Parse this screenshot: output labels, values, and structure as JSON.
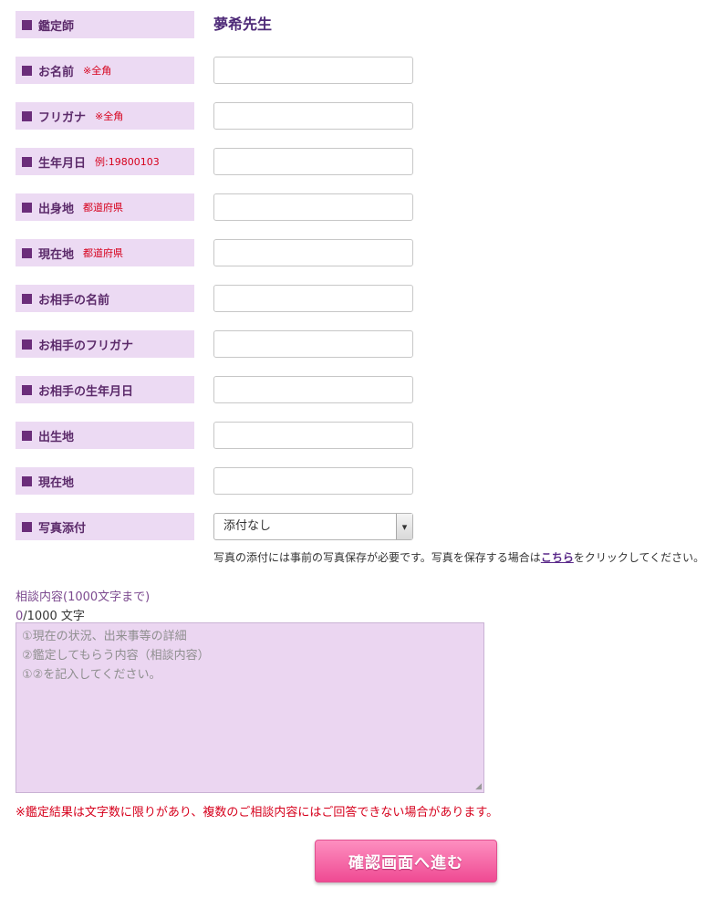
{
  "form": {
    "fields": [
      {
        "label": "鑑定師",
        "note": "",
        "type": "static",
        "value": "夢希先生"
      },
      {
        "label": "お名前",
        "note": "※全角",
        "type": "input",
        "value": ""
      },
      {
        "label": "フリガナ",
        "note": "※全角",
        "type": "input",
        "value": ""
      },
      {
        "label": "生年月日",
        "note": "例:19800103",
        "type": "input",
        "value": ""
      },
      {
        "label": "出身地",
        "note": "都道府県",
        "type": "input",
        "value": ""
      },
      {
        "label": "現在地",
        "note": "都道府県",
        "type": "input",
        "value": ""
      },
      {
        "label": "お相手の名前",
        "note": "",
        "type": "input",
        "value": ""
      },
      {
        "label": "お相手のフリガナ",
        "note": "",
        "type": "input",
        "value": ""
      },
      {
        "label": "お相手の生年月日",
        "note": "",
        "type": "input",
        "value": ""
      },
      {
        "label": "出生地",
        "note": "",
        "type": "input",
        "value": ""
      },
      {
        "label": "現在地",
        "note": "",
        "type": "input",
        "value": ""
      },
      {
        "label": "写真添付",
        "note": "",
        "type": "select",
        "value": "添付なし"
      }
    ],
    "photo_note_before": "写真の添付には事前の写真保存が必要です。写真を保存する場合は",
    "photo_note_link": "こちら",
    "photo_note_after": "をクリックしてください。"
  },
  "consultation": {
    "label": "相談内容(1000文字まで)",
    "count_current": "0",
    "count_suffix": "/1000 文字",
    "placeholder": "①現在の状況、出来事等の詳細\n②鑑定してもらう内容（相談内容）\n①②を記入してください。"
  },
  "warning": "※鑑定結果は文字数に限りがあり、複数のご相談内容にはご回答できない場合があります。",
  "submit_label": "確認画面へ進む",
  "icons": {
    "select_arrow": "chevron-down-icon",
    "resize": "resize-handle-icon"
  },
  "colors": {
    "label_bg": "#ecdaf3",
    "bullet": "#6b2d7a",
    "note": "#d6001c",
    "button": "#ef4a93"
  }
}
